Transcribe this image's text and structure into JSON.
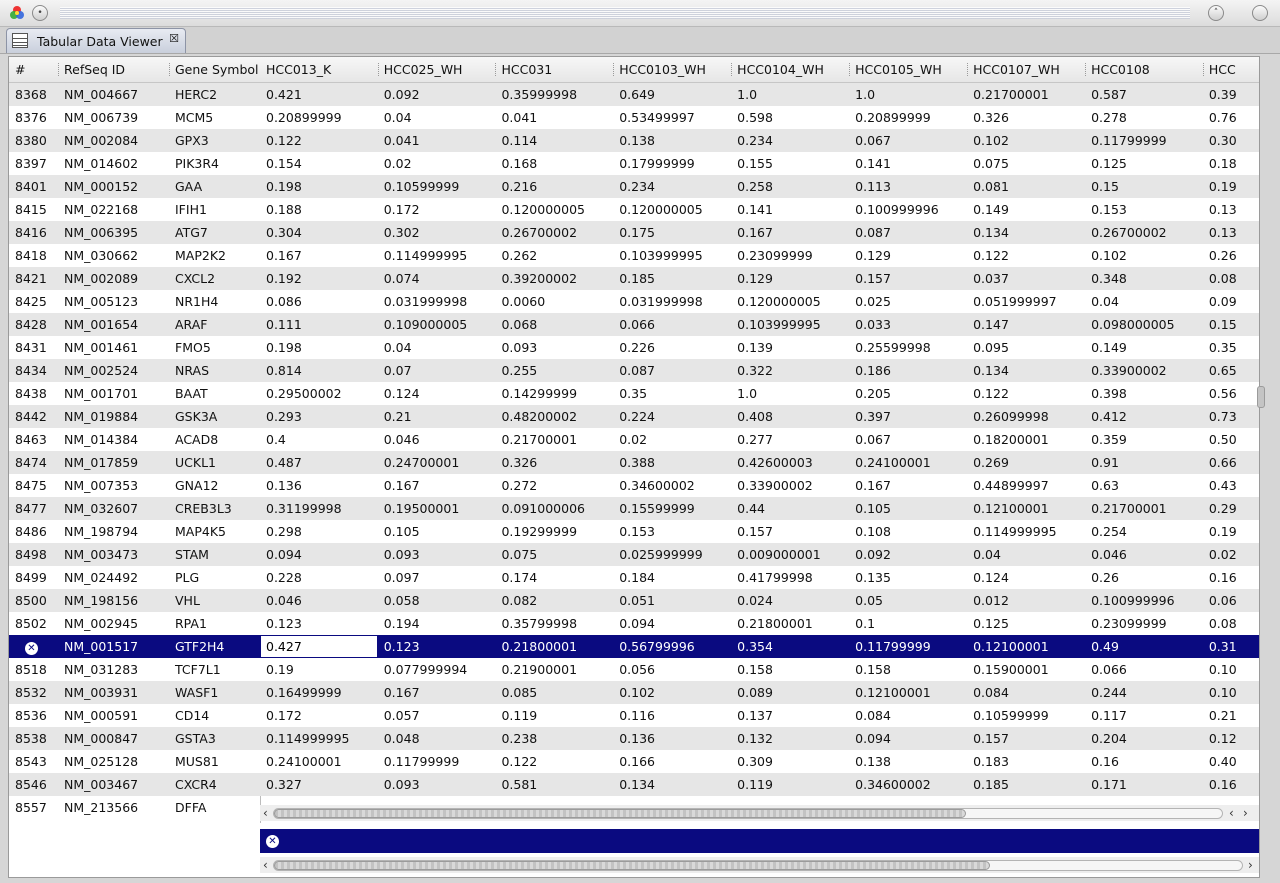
{
  "window": {
    "app_icon": "color-wheel-icon",
    "pin_icon": "pin-icon",
    "collapse_icon": "chevron-up-icon"
  },
  "tab": {
    "label": "Tabular Data Viewer",
    "icon": "table-icon",
    "close_icon": "close-icon"
  },
  "left_columns": [
    "#",
    "RefSeq ID",
    "Gene Symbol"
  ],
  "right_columns": [
    "HCC013_K",
    "HCC025_WH",
    "HCC031",
    "HCC0103_WH",
    "HCC0104_WH",
    "HCC0105_WH",
    "HCC0107_WH",
    "HCC0108",
    "HCC"
  ],
  "rows": [
    {
      "n": "8368",
      "id": "NM_004667",
      "gene": "HERC2",
      "v": [
        "0.421",
        "0.092",
        "0.35999998",
        "0.649",
        "1.0",
        "1.0",
        "0.21700001",
        "0.587",
        "0.39"
      ]
    },
    {
      "n": "8376",
      "id": "NM_006739",
      "gene": "MCM5",
      "v": [
        "0.20899999",
        "0.04",
        "0.041",
        "0.53499997",
        "0.598",
        "0.20899999",
        "0.326",
        "0.278",
        "0.76"
      ]
    },
    {
      "n": "8380",
      "id": "NM_002084",
      "gene": "GPX3",
      "v": [
        "0.122",
        "0.041",
        "0.114",
        "0.138",
        "0.234",
        "0.067",
        "0.102",
        "0.11799999",
        "0.30"
      ]
    },
    {
      "n": "8397",
      "id": "NM_014602",
      "gene": "PIK3R4",
      "v": [
        "0.154",
        "0.02",
        "0.168",
        "0.17999999",
        "0.155",
        "0.141",
        "0.075",
        "0.125",
        "0.18"
      ]
    },
    {
      "n": "8401",
      "id": "NM_000152",
      "gene": "GAA",
      "v": [
        "0.198",
        "0.10599999",
        "0.216",
        "0.234",
        "0.258",
        "0.113",
        "0.081",
        "0.15",
        "0.19"
      ]
    },
    {
      "n": "8415",
      "id": "NM_022168",
      "gene": "IFIH1",
      "v": [
        "0.188",
        "0.172",
        "0.120000005",
        "0.120000005",
        "0.141",
        "0.100999996",
        "0.149",
        "0.153",
        "0.13"
      ]
    },
    {
      "n": "8416",
      "id": "NM_006395",
      "gene": "ATG7",
      "v": [
        "0.304",
        "0.302",
        "0.26700002",
        "0.175",
        "0.167",
        "0.087",
        "0.134",
        "0.26700002",
        "0.13"
      ]
    },
    {
      "n": "8418",
      "id": "NM_030662",
      "gene": "MAP2K2",
      "v": [
        "0.167",
        "0.114999995",
        "0.262",
        "0.103999995",
        "0.23099999",
        "0.129",
        "0.122",
        "0.102",
        "0.26"
      ]
    },
    {
      "n": "8421",
      "id": "NM_002089",
      "gene": "CXCL2",
      "v": [
        "0.192",
        "0.074",
        "0.39200002",
        "0.185",
        "0.129",
        "0.157",
        "0.037",
        "0.348",
        "0.08"
      ]
    },
    {
      "n": "8425",
      "id": "NM_005123",
      "gene": "NR1H4",
      "v": [
        "0.086",
        "0.031999998",
        "0.0060",
        "0.031999998",
        "0.120000005",
        "0.025",
        "0.051999997",
        "0.04",
        "0.09"
      ]
    },
    {
      "n": "8428",
      "id": "NM_001654",
      "gene": "ARAF",
      "v": [
        "0.111",
        "0.109000005",
        "0.068",
        "0.066",
        "0.103999995",
        "0.033",
        "0.147",
        "0.098000005",
        "0.15"
      ]
    },
    {
      "n": "8431",
      "id": "NM_001461",
      "gene": "FMO5",
      "v": [
        "0.198",
        "0.04",
        "0.093",
        "0.226",
        "0.139",
        "0.25599998",
        "0.095",
        "0.149",
        "0.35"
      ]
    },
    {
      "n": "8434",
      "id": "NM_002524",
      "gene": "NRAS",
      "v": [
        "0.814",
        "0.07",
        "0.255",
        "0.087",
        "0.322",
        "0.186",
        "0.134",
        "0.33900002",
        "0.65"
      ]
    },
    {
      "n": "8438",
      "id": "NM_001701",
      "gene": "BAAT",
      "v": [
        "0.29500002",
        "0.124",
        "0.14299999",
        "0.35",
        "1.0",
        "0.205",
        "0.122",
        "0.398",
        "0.56"
      ]
    },
    {
      "n": "8442",
      "id": "NM_019884",
      "gene": "GSK3A",
      "v": [
        "0.293",
        "0.21",
        "0.48200002",
        "0.224",
        "0.408",
        "0.397",
        "0.26099998",
        "0.412",
        "0.73"
      ]
    },
    {
      "n": "8463",
      "id": "NM_014384",
      "gene": "ACAD8",
      "v": [
        "0.4",
        "0.046",
        "0.21700001",
        "0.02",
        "0.277",
        "0.067",
        "0.18200001",
        "0.359",
        "0.50"
      ]
    },
    {
      "n": "8474",
      "id": "NM_017859",
      "gene": "UCKL1",
      "v": [
        "0.487",
        "0.24700001",
        "0.326",
        "0.388",
        "0.42600003",
        "0.24100001",
        "0.269",
        "0.91",
        "0.66"
      ]
    },
    {
      "n": "8475",
      "id": "NM_007353",
      "gene": "GNA12",
      "v": [
        "0.136",
        "0.167",
        "0.272",
        "0.34600002",
        "0.33900002",
        "0.167",
        "0.44899997",
        "0.63",
        "0.43"
      ]
    },
    {
      "n": "8477",
      "id": "NM_032607",
      "gene": "CREB3L3",
      "v": [
        "0.31199998",
        "0.19500001",
        "0.091000006",
        "0.15599999",
        "0.44",
        "0.105",
        "0.12100001",
        "0.21700001",
        "0.29"
      ]
    },
    {
      "n": "8486",
      "id": "NM_198794",
      "gene": "MAP4K5",
      "v": [
        "0.298",
        "0.105",
        "0.19299999",
        "0.153",
        "0.157",
        "0.108",
        "0.114999995",
        "0.254",
        "0.19"
      ]
    },
    {
      "n": "8498",
      "id": "NM_003473",
      "gene": "STAM",
      "v": [
        "0.094",
        "0.093",
        "0.075",
        "0.025999999",
        "0.009000001",
        "0.092",
        "0.04",
        "0.046",
        "0.02"
      ]
    },
    {
      "n": "8499",
      "id": "NM_024492",
      "gene": "PLG",
      "v": [
        "0.228",
        "0.097",
        "0.174",
        "0.184",
        "0.41799998",
        "0.135",
        "0.124",
        "0.26",
        "0.16"
      ]
    },
    {
      "n": "8500",
      "id": "NM_198156",
      "gene": "VHL",
      "v": [
        "0.046",
        "0.058",
        "0.082",
        "0.051",
        "0.024",
        "0.05",
        "0.012",
        "0.100999996",
        "0.06"
      ]
    },
    {
      "n": "8502",
      "id": "NM_002945",
      "gene": "RPA1",
      "v": [
        "0.123",
        "0.194",
        "0.35799998",
        "0.094",
        "0.21800001",
        "0.1",
        "0.125",
        "0.23099999",
        "0.08"
      ]
    },
    {
      "n": "",
      "id": "NM_001517",
      "gene": "GTF2H4",
      "v": [
        "0.427",
        "0.123",
        "0.21800001",
        "0.56799996",
        "0.354",
        "0.11799999",
        "0.12100001",
        "0.49",
        "0.31"
      ],
      "selected": true
    },
    {
      "n": "8518",
      "id": "NM_031283",
      "gene": "TCF7L1",
      "v": [
        "0.19",
        "0.077999994",
        "0.21900001",
        "0.056",
        "0.158",
        "0.158",
        "0.15900001",
        "0.066",
        "0.10"
      ]
    },
    {
      "n": "8532",
      "id": "NM_003931",
      "gene": "WASF1",
      "v": [
        "0.16499999",
        "0.167",
        "0.085",
        "0.102",
        "0.089",
        "0.12100001",
        "0.084",
        "0.244",
        "0.10"
      ]
    },
    {
      "n": "8536",
      "id": "NM_000591",
      "gene": "CD14",
      "v": [
        "0.172",
        "0.057",
        "0.119",
        "0.116",
        "0.137",
        "0.084",
        "0.10599999",
        "0.117",
        "0.21"
      ]
    },
    {
      "n": "8538",
      "id": "NM_000847",
      "gene": "GSTA3",
      "v": [
        "0.114999995",
        "0.048",
        "0.238",
        "0.136",
        "0.132",
        "0.094",
        "0.157",
        "0.204",
        "0.12"
      ]
    },
    {
      "n": "8543",
      "id": "NM_025128",
      "gene": "MUS81",
      "v": [
        "0.24100001",
        "0.11799999",
        "0.122",
        "0.166",
        "0.309",
        "0.138",
        "0.183",
        "0.16",
        "0.40"
      ]
    },
    {
      "n": "8546",
      "id": "NM_003467",
      "gene": "CXCR4",
      "v": [
        "0.327",
        "0.093",
        "0.581",
        "0.134",
        "0.119",
        "0.34600002",
        "0.185",
        "0.171",
        "0.16"
      ]
    },
    {
      "n": "8557",
      "id": "NM_213566",
      "gene": "DFFA",
      "v": [
        "",
        "",
        "",
        "",
        "",
        "",
        "",
        "",
        ""
      ]
    }
  ],
  "scroll": {
    "table_h_fraction": 0.73,
    "status_h_fraction": 0.74
  }
}
